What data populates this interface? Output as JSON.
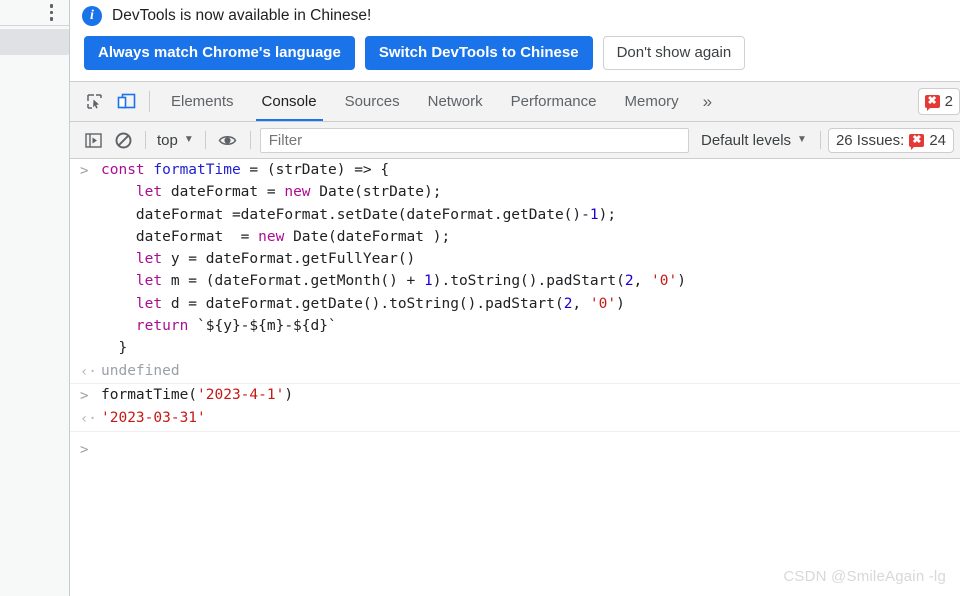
{
  "browser_strip": {
    "menu_icon": "kebab-menu-icon",
    "selected_row_label": ""
  },
  "banner": {
    "icon": "info-icon",
    "message": "DevTools is now available in Chinese!",
    "buttons": [
      {
        "label": "Always match Chrome's language",
        "style": "primary"
      },
      {
        "label": "Switch DevTools to Chinese",
        "style": "primary"
      },
      {
        "label": "Don't show again",
        "style": "secondary"
      }
    ]
  },
  "tabbar": {
    "inspect_icon": "inspect-element-icon",
    "device_icon": "device-toolbar-icon",
    "tabs": [
      {
        "label": "Elements",
        "active": false
      },
      {
        "label": "Console",
        "active": true
      },
      {
        "label": "Sources",
        "active": false
      },
      {
        "label": "Network",
        "active": false
      },
      {
        "label": "Performance",
        "active": false
      },
      {
        "label": "Memory",
        "active": false
      }
    ],
    "more_tabs_icon": "»",
    "error_chip": {
      "icon": "error-bubble-icon",
      "glyph": "✖",
      "count": "2"
    }
  },
  "console_toolbar": {
    "sidebar_icon": "console-sidebar-icon",
    "clear_icon": "clear-console-icon",
    "context_selector": {
      "value": "top",
      "caret": "▼"
    },
    "eye_icon": "live-expression-eye-icon",
    "filter": {
      "placeholder": "Filter",
      "value": ""
    },
    "levels_selector": {
      "value": "Default levels",
      "caret": "▼"
    },
    "issues": {
      "label": "26 Issues:",
      "icon": "error-bubble-icon",
      "glyph": "✖",
      "count": "24"
    }
  },
  "console": {
    "input_marker": ">",
    "output_marker": "‹·",
    "entries": [
      {
        "type": "input",
        "lines": [
          [
            {
              "t": "const ",
              "c": "kw"
            },
            {
              "t": "formatTime",
              "c": "fn"
            },
            {
              "t": " = (strDate) => {",
              "c": "plain"
            }
          ],
          [
            {
              "t": "    let ",
              "c": "kw"
            },
            {
              "t": "dateFormat = ",
              "c": "plain"
            },
            {
              "t": "new ",
              "c": "kw"
            },
            {
              "t": "Date(strDate);",
              "c": "plain"
            }
          ],
          [
            {
              "t": "    dateFormat =dateFormat.setDate(dateFormat.getDate()-",
              "c": "plain"
            },
            {
              "t": "1",
              "c": "num"
            },
            {
              "t": ");",
              "c": "plain"
            }
          ],
          [
            {
              "t": "    dateFormat  = ",
              "c": "plain"
            },
            {
              "t": "new ",
              "c": "kw"
            },
            {
              "t": "Date(dateFormat );",
              "c": "plain"
            }
          ],
          [
            {
              "t": "    let ",
              "c": "kw"
            },
            {
              "t": "y = dateFormat.getFullYear()",
              "c": "plain"
            }
          ],
          [
            {
              "t": "    let ",
              "c": "kw"
            },
            {
              "t": "m = (dateFormat.getMonth() + ",
              "c": "plain"
            },
            {
              "t": "1",
              "c": "num"
            },
            {
              "t": ").toString().padStart(",
              "c": "plain"
            },
            {
              "t": "2",
              "c": "num"
            },
            {
              "t": ", ",
              "c": "plain"
            },
            {
              "t": "'0'",
              "c": "str"
            },
            {
              "t": ")",
              "c": "plain"
            }
          ],
          [
            {
              "t": "    let ",
              "c": "kw"
            },
            {
              "t": "d = dateFormat.getDate().toString().padStart(",
              "c": "plain"
            },
            {
              "t": "2",
              "c": "num"
            },
            {
              "t": ", ",
              "c": "plain"
            },
            {
              "t": "'0'",
              "c": "str"
            },
            {
              "t": ")",
              "c": "plain"
            }
          ],
          [
            {
              "t": "    return ",
              "c": "kw"
            },
            {
              "t": "`${y}-${m}-${d}`",
              "c": "plain"
            }
          ],
          [
            {
              "t": "  }",
              "c": "plain"
            }
          ]
        ]
      },
      {
        "type": "output",
        "lines": [
          [
            {
              "t": "undefined",
              "c": "undef"
            }
          ]
        ]
      },
      {
        "type": "input",
        "lines": [
          [
            {
              "t": "formatTime(",
              "c": "plain"
            },
            {
              "t": "'2023-4-1'",
              "c": "str"
            },
            {
              "t": ")",
              "c": "plain"
            }
          ]
        ]
      },
      {
        "type": "output",
        "lines": [
          [
            {
              "t": "'2023-03-31'",
              "c": "result"
            }
          ]
        ]
      }
    ],
    "prompt_marker": ">"
  },
  "watermark": "CSDN @SmileAgain -lg",
  "colors": {
    "accent_blue": "#1a73e8",
    "error_red": "#e53935",
    "keyword_magenta": "#aa0d91",
    "string_red": "#c41a16",
    "number_blue": "#1c00cf",
    "identifier_blue": "#1f1fd0"
  }
}
